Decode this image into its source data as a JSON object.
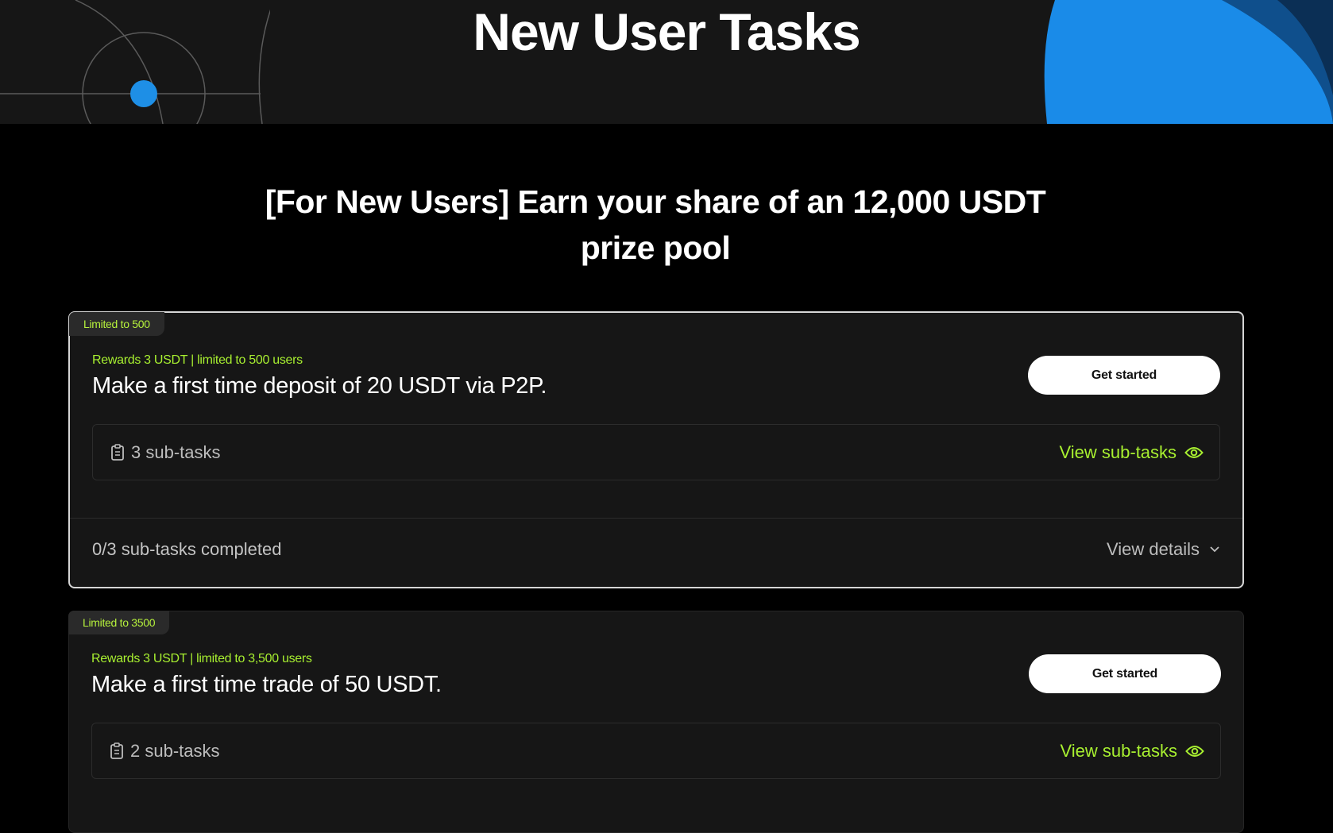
{
  "hero": {
    "title": "New User Tasks",
    "accent_color": "#1e8fe6"
  },
  "campaign": {
    "title": "[For New Users] Earn your share of an 12,000 USDT prize pool"
  },
  "theme": {
    "highlight_green": "#a8f030",
    "card_background": "#161616",
    "button_background": "#ffffff"
  },
  "tasks": [
    {
      "tag": "Limited to 500",
      "reward": "Rewards 3 USDT | limited to 500 users",
      "title": "Make a first time deposit of 20 USDT via P2P.",
      "button_label": "Get started",
      "subtask_count": "3 sub-tasks",
      "subtask_icon": "clipboard-icon",
      "view_subtasks_label": "View sub-tasks",
      "view_subtasks_icon": "eye-icon",
      "progress": "0/3 sub-tasks completed",
      "details_label": "View details",
      "details_icon": "chevron-down-icon",
      "selected": true
    },
    {
      "tag": "Limited to 3500",
      "reward": "Rewards 3 USDT | limited to 3,500 users",
      "title": "Make a first time trade of 50 USDT.",
      "button_label": "Get started",
      "subtask_count": "2 sub-tasks",
      "subtask_icon": "clipboard-icon",
      "view_subtasks_label": "View sub-tasks",
      "view_subtasks_icon": "eye-icon",
      "selected": false
    }
  ]
}
